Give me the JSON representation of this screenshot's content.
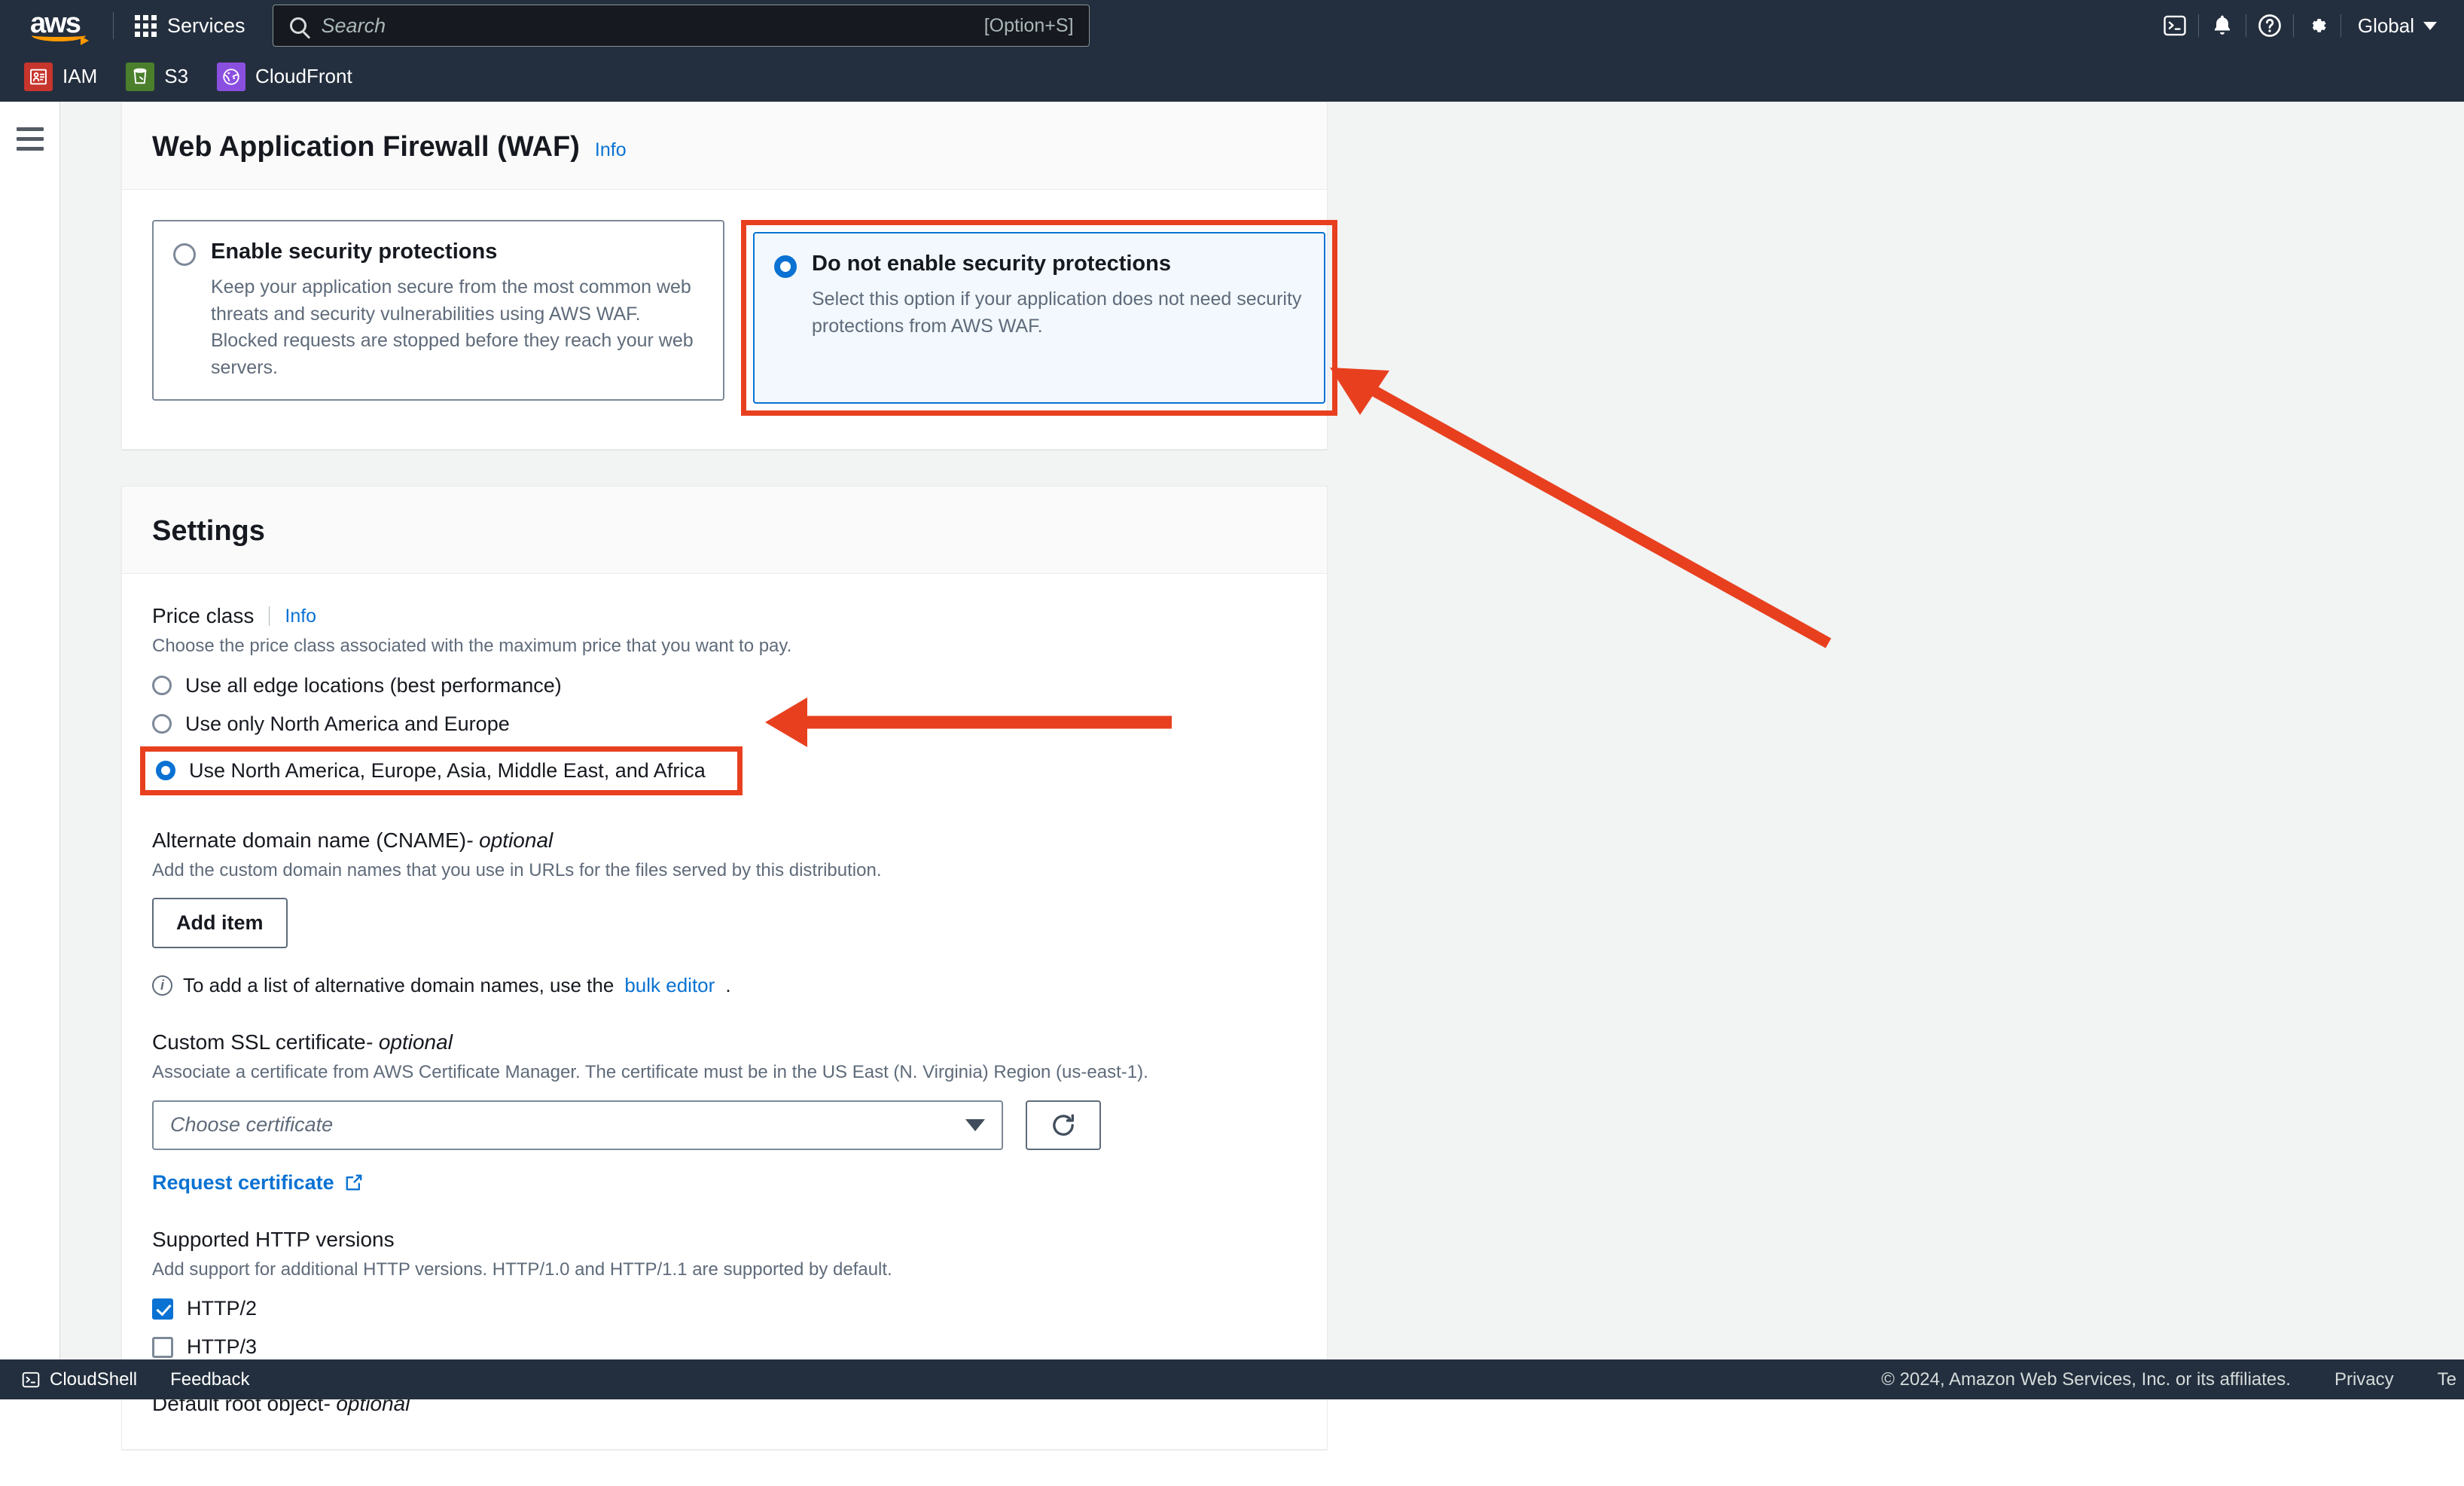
{
  "topnav": {
    "logo_alt": "aws",
    "services_label": "Services",
    "search_placeholder": "Search",
    "search_value": "",
    "search_shortcut": "[Option+S]",
    "region_label": "Global",
    "icons": [
      "cloudshell-icon",
      "notifications-bell-icon",
      "help-question-icon",
      "settings-gear-icon"
    ]
  },
  "service_tabs": [
    {
      "label": "IAM",
      "icon": "iam-service-icon",
      "color": "#c7352d"
    },
    {
      "label": "S3",
      "icon": "s3-bucket-icon",
      "color": "#4b7f2c"
    },
    {
      "label": "CloudFront",
      "icon": "cloudfront-globe-icon",
      "color": "#8b4fe0"
    }
  ],
  "waf": {
    "title": "Web Application Firewall (WAF)",
    "info_label": "Info",
    "options": [
      {
        "title": "Enable security protections",
        "description": "Keep your application secure from the most common web threats and security vulnerabilities using AWS WAF. Blocked requests are stopped before they reach your web servers.",
        "selected": false,
        "highlighted": false
      },
      {
        "title": "Do not enable security protections",
        "description": "Select this option if your application does not need security protections from AWS WAF.",
        "selected": true,
        "highlighted": true
      }
    ]
  },
  "settings": {
    "title": "Settings",
    "price_class": {
      "label": "Price class",
      "info_label": "Info",
      "description": "Choose the price class associated with the maximum price that you want to pay.",
      "options": [
        {
          "label": "Use all edge locations (best performance)",
          "selected": false,
          "highlighted": false
        },
        {
          "label": "Use only North America and Europe",
          "selected": false,
          "highlighted": false
        },
        {
          "label": "Use North America, Europe, Asia, Middle East, and Africa",
          "selected": true,
          "highlighted": true
        }
      ]
    },
    "alternate_domain": {
      "label": "Alternate domain name (CNAME)",
      "label_optional": " - optional",
      "description": "Add the custom domain names that you use in URLs for the files served by this distribution.",
      "add_item_button": "Add item",
      "hint_prefix": "To add a list of alternative domain names, use the ",
      "hint_link": "bulk editor",
      "hint_suffix": "."
    },
    "ssl": {
      "label": "Custom SSL certificate",
      "label_optional": " - optional",
      "description": "Associate a certificate from AWS Certificate Manager. The certificate must be in the US East (N. Virginia) Region (us-east-1).",
      "select_placeholder": "Choose certificate",
      "select_value": "",
      "refresh_icon": "refresh-icon",
      "request_link": "Request certificate",
      "request_link_icon": "external-link-icon"
    },
    "http_versions": {
      "label": "Supported HTTP versions",
      "description": "Add support for additional HTTP versions. HTTP/1.0 and HTTP/1.1 are supported by default.",
      "options": [
        {
          "label": "HTTP/2",
          "checked": true
        },
        {
          "label": "HTTP/3",
          "checked": false
        }
      ]
    },
    "default_root_object": {
      "label": "Default root object",
      "label_optional": " - optional"
    }
  },
  "annotations": {
    "accent_color": "#e8401f",
    "arrows": [
      {
        "name": "arrow-to-waf-option",
        "type": "diagonal"
      },
      {
        "name": "arrow-to-price-class-option",
        "type": "horizontal"
      }
    ]
  },
  "footer": {
    "cloudshell_label": "CloudShell",
    "feedback_label": "Feedback",
    "copyright": "© 2024, Amazon Web Services, Inc. or its affiliates.",
    "privacy_label": "Privacy",
    "terms_label": "Te"
  }
}
